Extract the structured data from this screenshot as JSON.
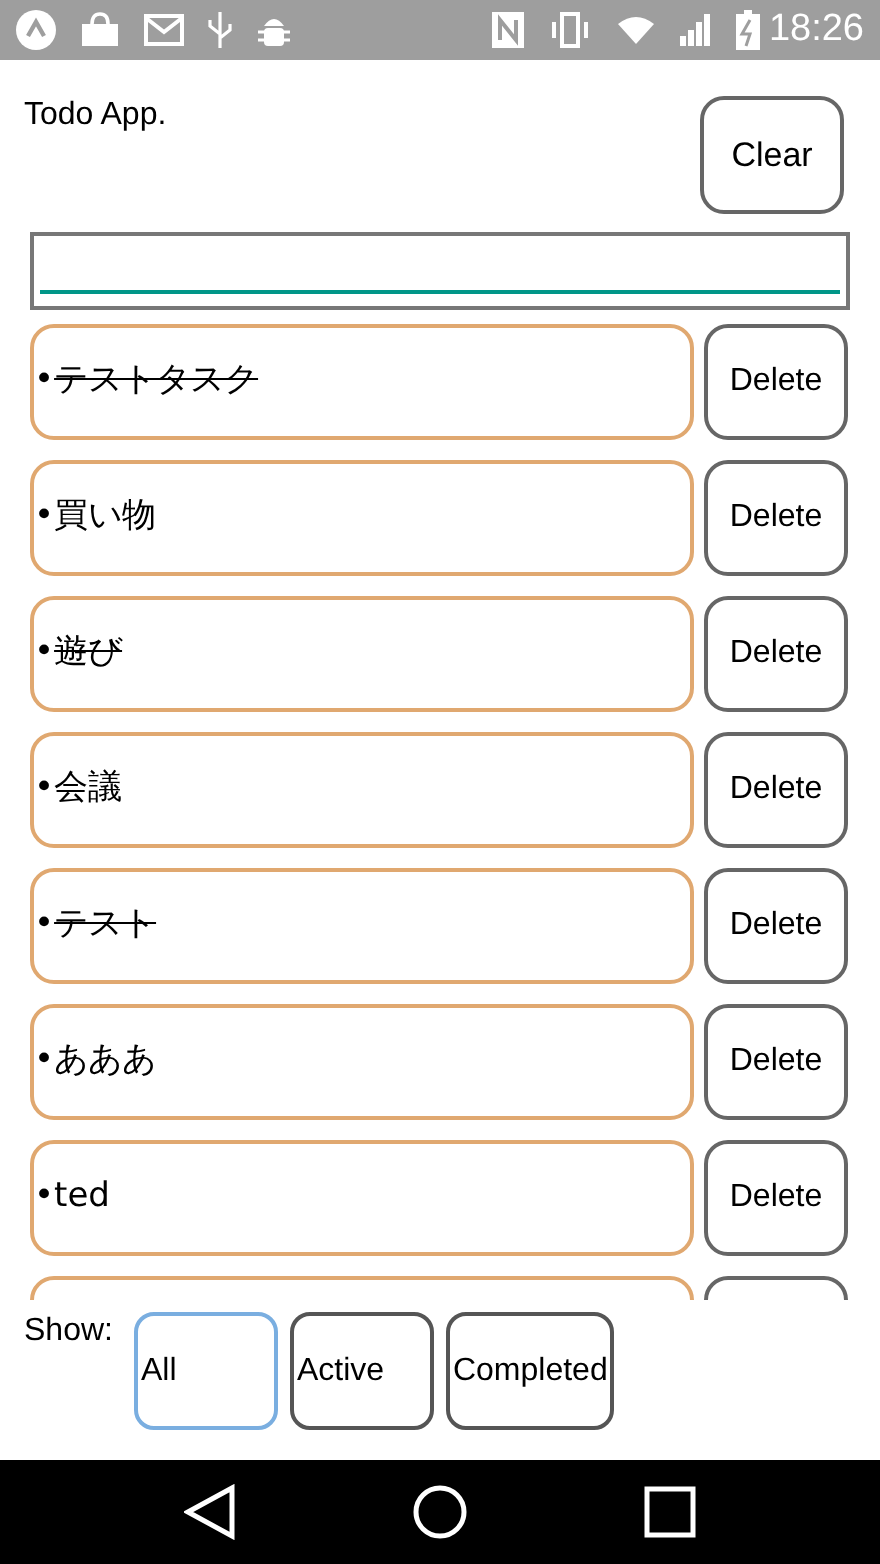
{
  "status_bar": {
    "time": "18:26"
  },
  "header": {
    "title": "Todo App.",
    "clear_button": "Clear"
  },
  "todos": [
    {
      "bullet": "•",
      "text": "テストタスク",
      "completed": true,
      "delete_label": "Delete"
    },
    {
      "bullet": "•",
      "text": "買い物",
      "completed": false,
      "delete_label": "Delete"
    },
    {
      "bullet": "•",
      "text": "遊び",
      "completed": true,
      "delete_label": "Delete"
    },
    {
      "bullet": "•",
      "text": "会議",
      "completed": false,
      "delete_label": "Delete"
    },
    {
      "bullet": "•",
      "text": "テスト",
      "completed": true,
      "delete_label": "Delete"
    },
    {
      "bullet": "•",
      "text": "あああ",
      "completed": false,
      "delete_label": "Delete"
    },
    {
      "bullet": "•",
      "text": "ted",
      "completed": false,
      "delete_label": "Delete"
    }
  ],
  "filter": {
    "label": "Show:",
    "options": [
      {
        "label": "All",
        "selected": true
      },
      {
        "label": "Active",
        "selected": false
      },
      {
        "label": "Completed",
        "selected": false
      }
    ]
  }
}
